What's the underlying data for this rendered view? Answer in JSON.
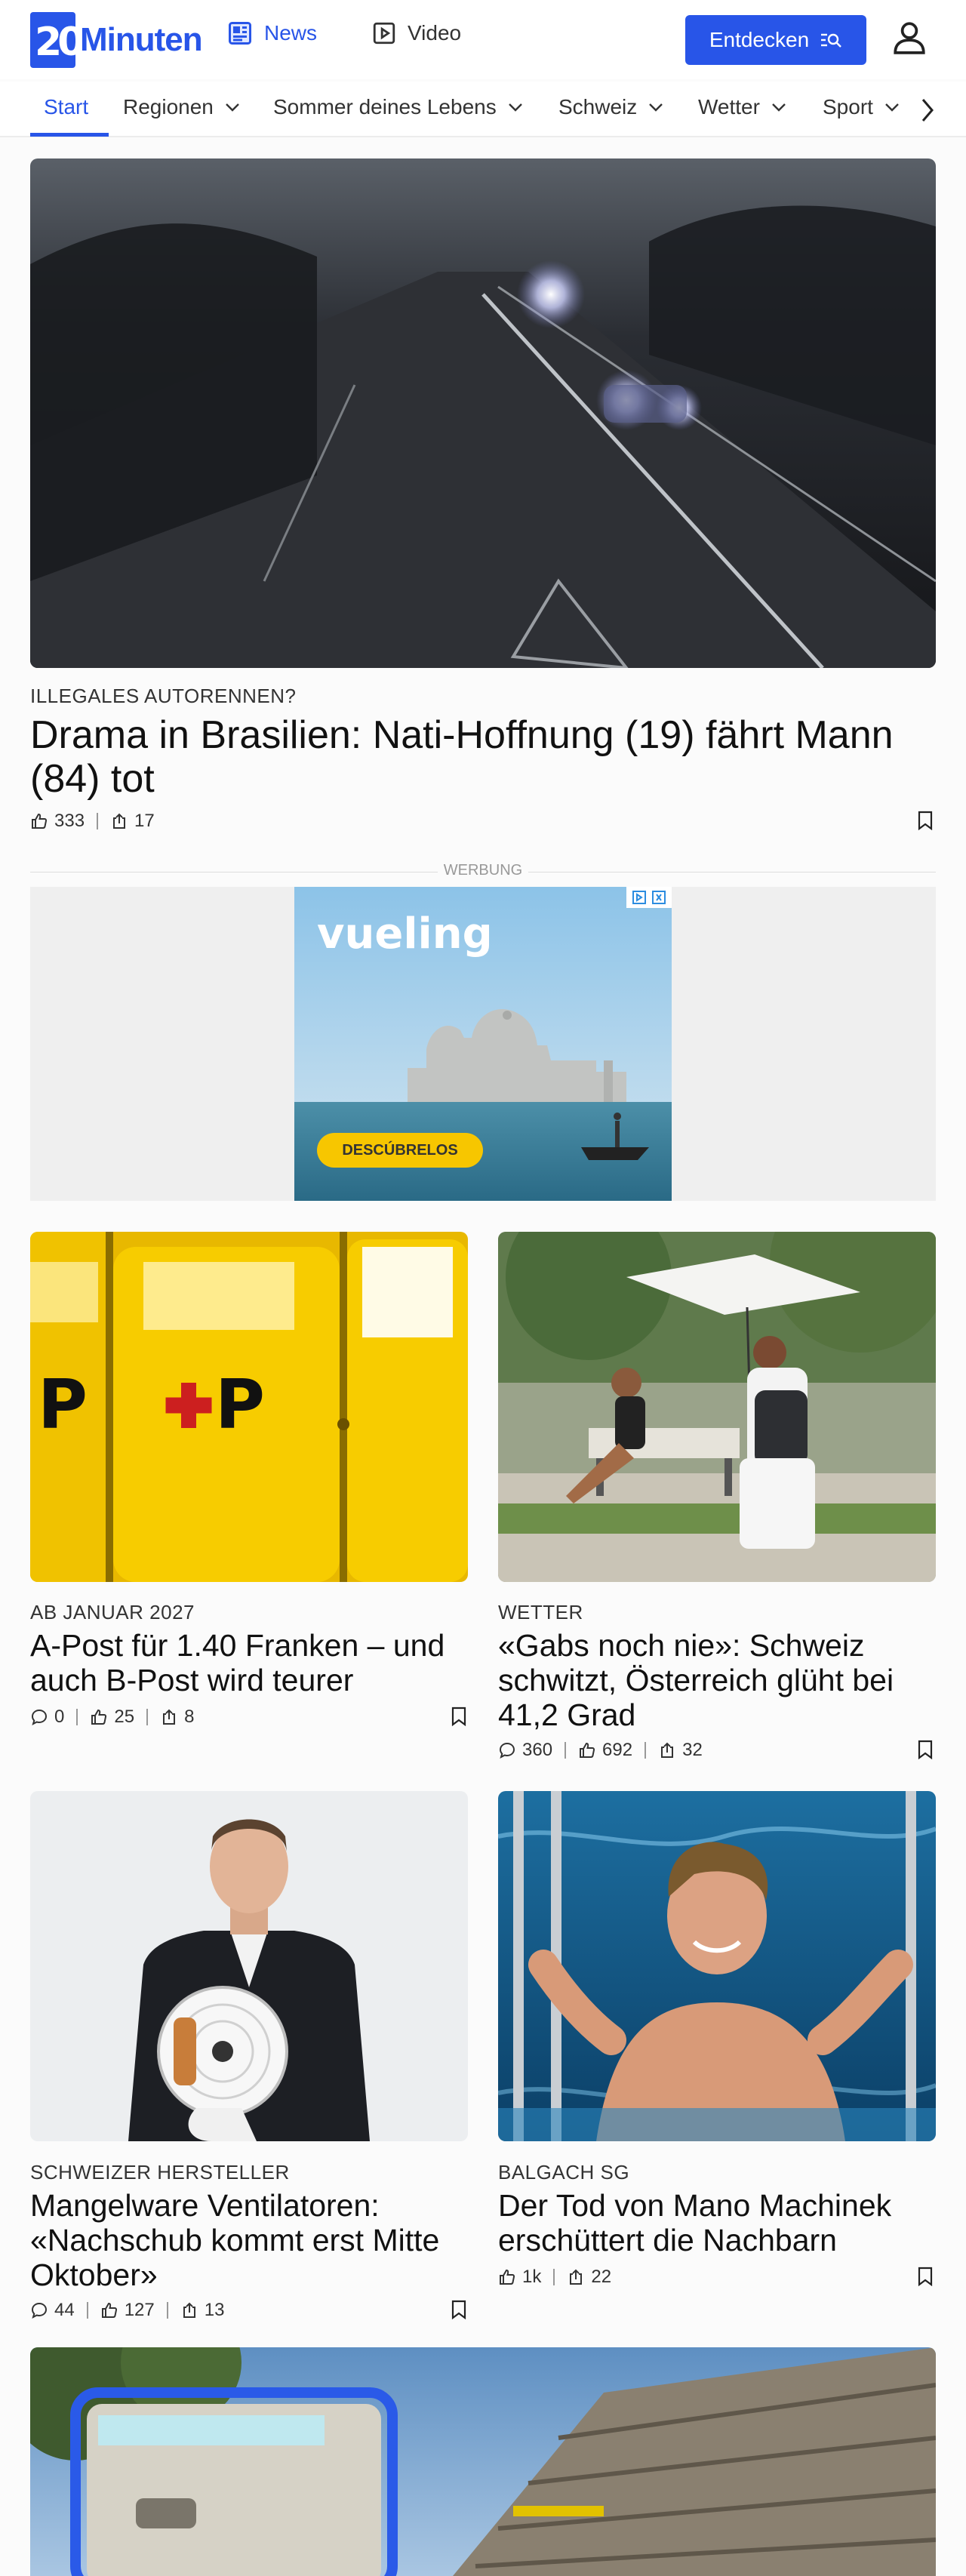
{
  "header": {
    "logo_text": "Minuten",
    "logo_number": "20",
    "nav": [
      {
        "label": "News",
        "icon": "news-icon",
        "active": true
      },
      {
        "label": "Video",
        "icon": "play-icon",
        "active": false
      }
    ],
    "discover_label": "Entdecken",
    "user_icon": "user-icon",
    "accent": "#2855e8"
  },
  "tabs": [
    {
      "label": "Start",
      "dropdown": false
    },
    {
      "label": "Regionen",
      "dropdown": true
    },
    {
      "label": "Sommer deines Lebens",
      "dropdown": true
    },
    {
      "label": "Schweiz",
      "dropdown": true
    },
    {
      "label": "Wetter",
      "dropdown": true
    },
    {
      "label": "Sport",
      "dropdown": true
    }
  ],
  "hero": {
    "kicker": "ILLEGALES AUTORENNEN?",
    "title": "Drama in Brasilien: Nati-Hoffnung (19) fährt Mann (84) tot",
    "likes": "333",
    "shares": "17"
  },
  "ad": {
    "label": "WERBUNG",
    "brand": "vueling",
    "cta": "DESCÚBRELOS"
  },
  "articles": [
    {
      "kicker": "AB JANUAR 2027",
      "title": "A-Post für 1.40 Franken – und auch B-Post wird teurer",
      "comments": "0",
      "likes": "25",
      "shares": "8"
    },
    {
      "kicker": "WETTER",
      "title": "«Gabs noch nie»: Schweiz schwitzt, Österreich glüht bei 41,2 Grad",
      "comments": "360",
      "likes": "692",
      "shares": "32"
    },
    {
      "kicker": "SCHWEIZER HERSTELLER",
      "title": "Mangelware Ventilatoren: «Nachschub kommt erst Mitte Oktober»",
      "comments": "44",
      "likes": "127",
      "shares": "13"
    },
    {
      "kicker": "BALGACH SG",
      "title": "Der Tod von Mano Machinek erschüttert die Nachbarn",
      "likes": "1k",
      "shares": "22"
    }
  ]
}
